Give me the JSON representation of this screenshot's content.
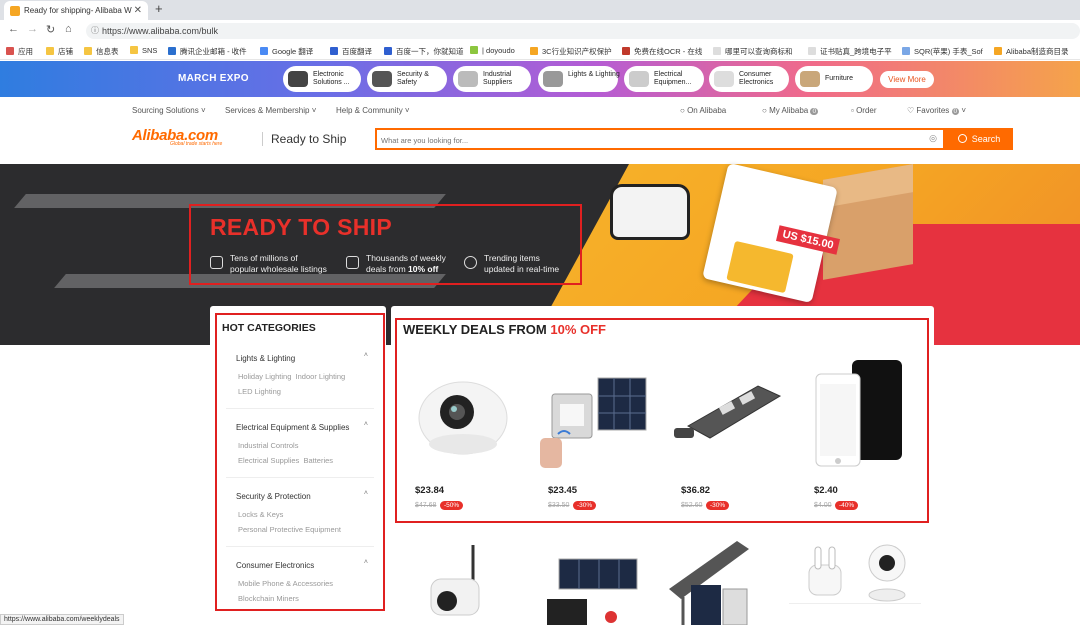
{
  "browser": {
    "tab_title": "Ready for shipping- Alibaba W",
    "url": "https://www.alibaba.com/bulk",
    "bookmarks": [
      "应用",
      "店铺",
      "信息表",
      "SNS",
      "腾讯企业邮箱 - 收件",
      "Google 翻译",
      "百度翻译",
      "百度一下，你就知道",
      "| doyoudo",
      "3C行业知识产权保护",
      "免费在线OCR - 在线",
      "哪里可以查询商标和",
      "证书贴真_跨境电子平",
      "SQR(苹果) 手表_Sof",
      "Alibaba制造商目录"
    ],
    "status_url": "https://www.alibaba.com/weeklydeals"
  },
  "expo": {
    "title": "MARCH EXPO",
    "items": [
      "Electronic Solutions ...",
      "Security & Safety",
      "Industrial Suppliers",
      "Lights & Lighting",
      "Electrical Equipmen...",
      "Consumer Electronics",
      "Furniture"
    ],
    "view_more": "View More"
  },
  "header": {
    "nav": [
      "Sourcing Solutions",
      "Services & Membership",
      "Help & Community"
    ],
    "on_alibaba": "On Alibaba",
    "my_alibaba": "My Alibaba",
    "my_count": "0",
    "order": "Order",
    "favorites": "Favorites",
    "fav_count": "0",
    "logo": "Alibaba.com",
    "logo_sub": "Global trade starts here",
    "ready_to_ship": "Ready to Ship",
    "search_placeholder": "What are you looking for...",
    "search_btn": "Search"
  },
  "hero": {
    "title": "READY TO SHIP",
    "f1a": "Tens of millions of",
    "f1b": "popular wholesale listings",
    "f2a": "Thousands of weekly",
    "f2b_pre": "deals from ",
    "f2b_bold": "10% off",
    "f3a": "Trending items",
    "f3b": "updated in real-time",
    "price_tag": "US $15.00"
  },
  "categories": {
    "title": "HOT CATEGORIES",
    "groups": [
      {
        "name": "Lights & Lighting",
        "sub1": "Holiday Lighting",
        "sub1b": "Indoor Lighting",
        "sub2": "LED Lighting"
      },
      {
        "name": "Electrical Equipment & Supplies",
        "sub1": "Industrial Controls",
        "sub2": "Electrical Supplies",
        "sub2b": "Batteries"
      },
      {
        "name": "Security & Protection",
        "sub1": "Locks & Keys",
        "sub2": "Personal Protective Equipment"
      },
      {
        "name": "Consumer Electronics",
        "sub1": "Mobile Phone & Accessories",
        "sub2": "Blockchain Miners"
      }
    ]
  },
  "deals": {
    "title_pre": "WEEKLY DEALS FROM ",
    "title_pct": "10% OFF",
    "products": [
      {
        "price": "$23.84",
        "old": "$47.68",
        "off": "-50%"
      },
      {
        "price": "$23.45",
        "old": "$33.50",
        "off": "-30%"
      },
      {
        "price": "$36.82",
        "old": "$52.60",
        "off": "-30%"
      },
      {
        "price": "$2.40",
        "old": "$4.00",
        "off": "-40%"
      }
    ]
  }
}
